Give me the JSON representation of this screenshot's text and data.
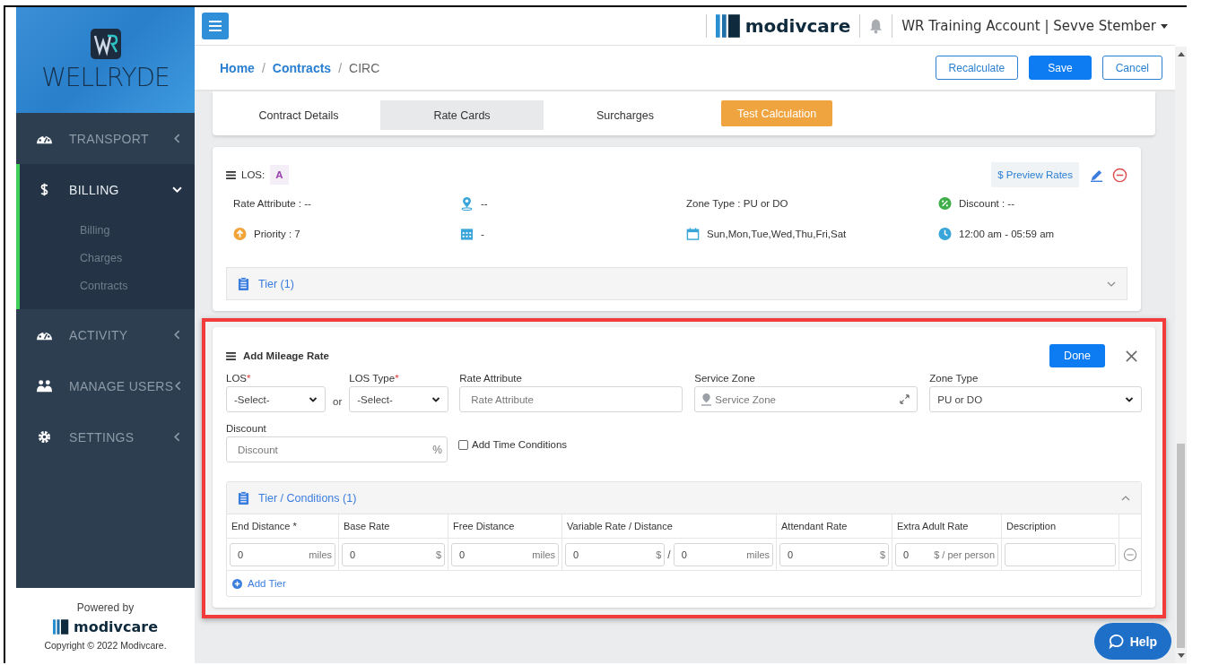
{
  "sidebar": {
    "brand": "WELLRYDE",
    "nav": [
      {
        "label": "TRANSPORT",
        "expanded": false,
        "active": false
      },
      {
        "label": "BILLING",
        "expanded": true,
        "active": true,
        "children": [
          {
            "label": "Billing"
          },
          {
            "label": "Charges"
          },
          {
            "label": "Contracts"
          }
        ]
      },
      {
        "label": "ACTIVITY",
        "expanded": false,
        "active": false
      },
      {
        "label": "MANAGE USERS",
        "expanded": false,
        "active": false
      },
      {
        "label": "SETTINGS",
        "expanded": false,
        "active": false
      }
    ],
    "footer": {
      "powered_by": "Powered by",
      "brand": "modivcare",
      "copyright": "Copyright © 2022 Modivcare."
    }
  },
  "topbar": {
    "brand": "modivcare",
    "account": "WR Training Account | Sevve Stember"
  },
  "breadcrumb_separator": "/",
  "breadcrumb": [
    {
      "label": "Home",
      "link": true
    },
    {
      "label": "Contracts",
      "link": true
    },
    {
      "label": "CIRC",
      "link": false
    }
  ],
  "actions": [
    {
      "label": "Recalculate",
      "kind": "outline"
    },
    {
      "label": "Save",
      "kind": "primary"
    },
    {
      "label": "Cancel",
      "kind": "outline"
    }
  ],
  "tabs": [
    {
      "label": "Contract Details",
      "kind": "tab",
      "selected": false
    },
    {
      "label": "Rate Cards",
      "kind": "tab",
      "selected": true
    },
    {
      "label": "Surcharges",
      "kind": "tab",
      "selected": false
    },
    {
      "label": "Test Calculation",
      "kind": "button",
      "selected": false
    }
  ],
  "los_card": {
    "los_label": "LOS:",
    "los_value": "A",
    "preview_button": "$ Preview Rates",
    "details": [
      {
        "text": "Rate Attribute : --"
      },
      {
        "text": "--"
      },
      {
        "text": "Zone Type : PU or DO"
      },
      {
        "text": "Discount : --"
      },
      {
        "text": "Priority : 7"
      },
      {
        "text": "-"
      },
      {
        "text": "Sun,Mon,Tue,Wed,Thu,Fri,Sat"
      },
      {
        "text": "12:00 am - 05:59 am"
      }
    ],
    "tier_panel": {
      "title": "Tier (1)",
      "expanded": false
    }
  },
  "mileage_form": {
    "title": "Add Mileage Rate",
    "done_button": "Done",
    "fields": [
      {
        "label": "LOS",
        "required": true,
        "kind": "select",
        "value": "-Select-"
      },
      {
        "label": "LOS Type",
        "required": true,
        "kind": "select",
        "value": "-Select-"
      },
      {
        "label": "Rate Attribute",
        "required": false,
        "kind": "text",
        "placeholder": "Rate Attribute"
      },
      {
        "label": "Service Zone",
        "required": false,
        "kind": "zone",
        "placeholder": "Service Zone"
      },
      {
        "label": "Zone Type",
        "required": false,
        "kind": "select",
        "value": "PU or DO"
      }
    ],
    "or_text": "or",
    "required_mark": "*",
    "discount": {
      "label": "Discount",
      "placeholder": "Discount",
      "unit": "%"
    },
    "time_conditions": {
      "label": "Add Time Conditions",
      "checked": false
    },
    "tiers": {
      "title": "Tier / Conditions (1)",
      "expanded": true,
      "columns": [
        "End Distance *",
        "Base Rate",
        "Free Distance",
        "Variable Rate / Distance",
        "Attendant Rate",
        "Extra Adult Rate",
        "Description"
      ],
      "rows": [
        {
          "cells": [
            {
              "kind": "unit",
              "inputs": [
                {
                  "value": "0",
                  "unit": "miles"
                }
              ]
            },
            {
              "kind": "unit",
              "inputs": [
                {
                  "value": "0",
                  "unit": "$"
                }
              ]
            },
            {
              "kind": "unit",
              "inputs": [
                {
                  "value": "0",
                  "unit": "miles"
                }
              ]
            },
            {
              "kind": "pair",
              "separator": "/",
              "inputs": [
                {
                  "value": "0",
                  "unit": "$"
                },
                {
                  "value": "0",
                  "unit": "miles"
                }
              ]
            },
            {
              "kind": "unit",
              "inputs": [
                {
                  "value": "0",
                  "unit": "$"
                }
              ]
            },
            {
              "kind": "unit",
              "inputs": [
                {
                  "value": "0",
                  "unit": "$ / per person"
                }
              ]
            },
            {
              "kind": "empty"
            }
          ]
        }
      ],
      "add_tier": "Add Tier"
    }
  },
  "help_button": "Help"
}
